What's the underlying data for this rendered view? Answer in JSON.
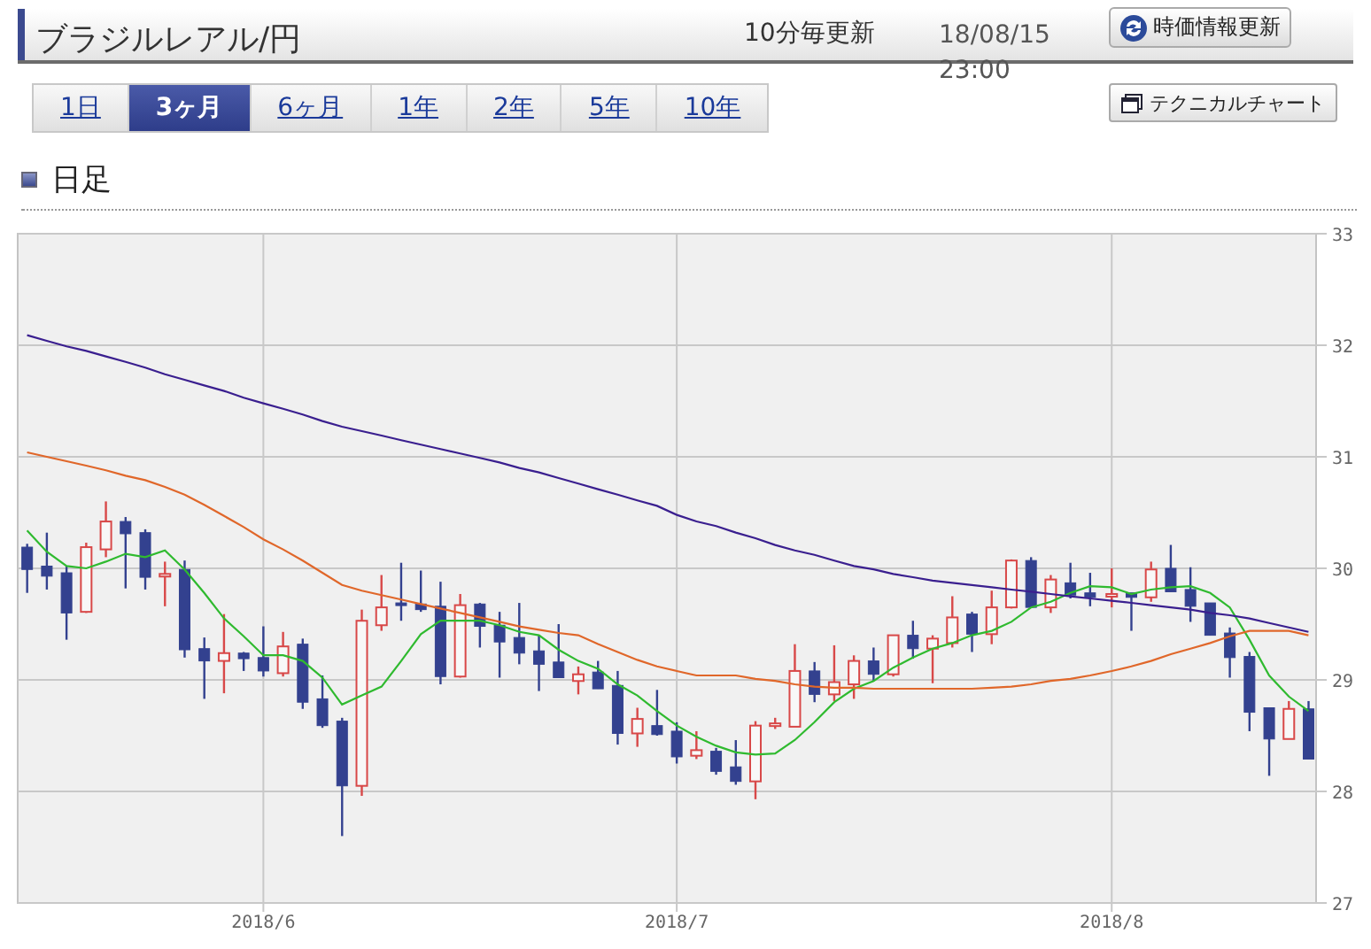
{
  "header": {
    "title": "ブラジルレアル/円",
    "update_interval": "10分毎更新",
    "timestamp": "18/08/15 23:00",
    "refresh_button": "時価情報更新"
  },
  "period_tabs": [
    {
      "label": "1日",
      "selected": false
    },
    {
      "label": "3ヶ月",
      "selected": true
    },
    {
      "label": "6ヶ月",
      "selected": false
    },
    {
      "label": "1年",
      "selected": false
    },
    {
      "label": "2年",
      "selected": false
    },
    {
      "label": "5年",
      "selected": false
    },
    {
      "label": "10年",
      "selected": false
    }
  ],
  "technical_chart_button": "テクニカルチャート",
  "section": {
    "title": "日足",
    "chart_data": {
      "type": "candlestick",
      "grid": true,
      "categories": [
        null,
        null,
        null,
        null,
        null,
        null,
        null,
        null,
        null,
        null,
        null,
        null,
        "2018/6",
        null,
        null,
        null,
        null,
        null,
        null,
        null,
        null,
        null,
        null,
        null,
        null,
        null,
        null,
        null,
        null,
        null,
        null,
        null,
        null,
        "2018/7",
        null,
        null,
        null,
        null,
        null,
        null,
        null,
        null,
        null,
        null,
        null,
        null,
        null,
        null,
        null,
        null,
        null,
        null,
        null,
        null,
        null,
        "2018/8",
        null,
        null,
        null,
        null,
        null,
        null,
        null,
        null,
        null,
        null
      ],
      "ylim": [
        27,
        33
      ],
      "yticks": [
        27,
        28,
        29,
        30,
        31,
        32,
        33
      ],
      "series": [
        {
          "type": "line",
          "color": "#2fba2f",
          "values": [
            30.34,
            30.15,
            30.02,
            30.0,
            30.06,
            30.13,
            30.1,
            30.16,
            29.99,
            29.78,
            29.55,
            29.39,
            29.22,
            29.22,
            29.17,
            29.02,
            28.78,
            28.86,
            28.94,
            29.17,
            29.41,
            29.53,
            29.53,
            29.53,
            29.49,
            29.43,
            29.4,
            29.27,
            29.17,
            29.1,
            28.96,
            28.86,
            28.72,
            28.59,
            28.49,
            28.41,
            28.35,
            28.33,
            28.34,
            28.46,
            28.62,
            28.8,
            28.92,
            28.99,
            29.11,
            29.2,
            29.28,
            29.33,
            29.4,
            29.44,
            29.52,
            29.65,
            29.7,
            29.78,
            29.84,
            29.83,
            29.77,
            29.81,
            29.83,
            29.84,
            29.78,
            29.65,
            29.36,
            29.04,
            28.85,
            28.72
          ]
        },
        {
          "type": "line",
          "color": "#e0672a",
          "values": [
            31.04,
            31.0,
            30.96,
            30.92,
            30.88,
            30.83,
            30.79,
            30.73,
            30.66,
            30.57,
            30.47,
            30.37,
            30.26,
            30.17,
            30.07,
            29.96,
            29.85,
            29.8,
            29.76,
            29.72,
            29.68,
            29.64,
            29.6,
            29.56,
            29.52,
            29.48,
            29.45,
            29.42,
            29.4,
            29.32,
            29.25,
            29.18,
            29.12,
            29.08,
            29.04,
            29.04,
            29.04,
            29.01,
            28.99,
            28.96,
            28.94,
            28.93,
            28.93,
            28.92,
            28.92,
            28.92,
            28.92,
            28.92,
            28.92,
            28.93,
            28.94,
            28.96,
            28.99,
            29.01,
            29.04,
            29.08,
            29.12,
            29.17,
            29.23,
            29.28,
            29.33,
            29.39,
            29.44,
            29.44,
            29.44,
            29.4
          ]
        },
        {
          "type": "line",
          "color": "#3a1f8f",
          "values": [
            32.09,
            32.04,
            31.99,
            31.95,
            31.9,
            31.85,
            31.8,
            31.74,
            31.69,
            31.64,
            31.59,
            31.53,
            31.48,
            31.43,
            31.38,
            31.32,
            31.27,
            31.23,
            31.19,
            31.15,
            31.11,
            31.07,
            31.03,
            30.99,
            30.95,
            30.9,
            30.86,
            30.81,
            30.76,
            30.71,
            30.66,
            30.61,
            30.56,
            30.48,
            30.42,
            30.38,
            30.32,
            30.27,
            30.21,
            30.16,
            30.12,
            30.07,
            30.02,
            29.99,
            29.95,
            29.92,
            29.89,
            29.87,
            29.85,
            29.83,
            29.81,
            29.79,
            29.77,
            29.75,
            29.73,
            29.71,
            29.69,
            29.67,
            29.65,
            29.63,
            29.6,
            29.58,
            29.55,
            29.51,
            29.47,
            29.43
          ]
        }
      ],
      "ohlc": [
        [
          30.19,
          30.22,
          29.78,
          29.99
        ],
        [
          30.02,
          30.32,
          29.81,
          29.93
        ],
        [
          29.96,
          30.02,
          29.36,
          29.6
        ],
        [
          29.61,
          30.23,
          29.6,
          30.19
        ],
        [
          30.17,
          30.6,
          30.1,
          30.42
        ],
        [
          30.42,
          30.46,
          29.82,
          30.31
        ],
        [
          30.32,
          30.35,
          29.81,
          29.92
        ],
        [
          29.94,
          30.06,
          29.66,
          29.95
        ],
        [
          29.99,
          30.07,
          29.2,
          29.27
        ],
        [
          29.28,
          29.38,
          28.83,
          29.17
        ],
        [
          29.17,
          29.59,
          28.88,
          29.24
        ],
        [
          29.24,
          29.25,
          29.08,
          29.19
        ],
        [
          29.2,
          29.48,
          29.03,
          29.08
        ],
        [
          29.06,
          29.43,
          29.03,
          29.3
        ],
        [
          29.32,
          29.37,
          28.74,
          28.8
        ],
        [
          28.83,
          29.04,
          28.57,
          28.59
        ],
        [
          28.63,
          28.66,
          27.6,
          28.05
        ],
        [
          28.05,
          29.63,
          27.96,
          29.53
        ],
        [
          29.49,
          29.94,
          29.44,
          29.65
        ],
        [
          29.69,
          30.05,
          29.53,
          29.67
        ],
        [
          29.68,
          29.98,
          29.61,
          29.63
        ],
        [
          29.66,
          29.88,
          28.96,
          29.03
        ],
        [
          29.03,
          29.77,
          29.02,
          29.67
        ],
        [
          29.68,
          29.69,
          29.29,
          29.48
        ],
        [
          29.49,
          29.61,
          29.02,
          29.34
        ],
        [
          29.38,
          29.69,
          29.14,
          29.24
        ],
        [
          29.26,
          29.4,
          28.9,
          29.14
        ],
        [
          29.16,
          29.5,
          29.02,
          29.02
        ],
        [
          28.99,
          29.12,
          28.87,
          29.05
        ],
        [
          29.07,
          29.17,
          28.92,
          28.92
        ],
        [
          28.95,
          29.08,
          28.42,
          28.52
        ],
        [
          28.52,
          28.75,
          28.4,
          28.65
        ],
        [
          28.59,
          28.91,
          28.5,
          28.51
        ],
        [
          28.54,
          28.62,
          28.25,
          28.31
        ],
        [
          28.32,
          28.54,
          28.29,
          28.37
        ],
        [
          28.36,
          28.39,
          28.15,
          28.18
        ],
        [
          28.22,
          28.46,
          28.06,
          28.09
        ],
        [
          28.09,
          28.63,
          27.93,
          28.59
        ],
        [
          28.6,
          28.66,
          28.56,
          28.61
        ],
        [
          28.58,
          29.32,
          28.58,
          29.08
        ],
        [
          29.08,
          29.16,
          28.8,
          28.87
        ],
        [
          28.87,
          29.31,
          28.81,
          28.98
        ],
        [
          28.96,
          29.22,
          28.83,
          29.17
        ],
        [
          29.17,
          29.29,
          28.99,
          29.05
        ],
        [
          29.05,
          29.4,
          29.03,
          29.4
        ],
        [
          29.4,
          29.53,
          29.19,
          29.28
        ],
        [
          29.28,
          29.4,
          28.97,
          29.37
        ],
        [
          29.33,
          29.75,
          29.29,
          29.56
        ],
        [
          29.59,
          29.61,
          29.25,
          29.41
        ],
        [
          29.41,
          29.8,
          29.32,
          29.65
        ],
        [
          29.65,
          30.08,
          29.64,
          30.07
        ],
        [
          30.07,
          30.1,
          29.65,
          29.65
        ],
        [
          29.65,
          29.94,
          29.6,
          29.9
        ],
        [
          29.87,
          30.05,
          29.73,
          29.76
        ],
        [
          29.78,
          29.96,
          29.66,
          29.74
        ],
        [
          29.76,
          30.0,
          29.65,
          29.77
        ],
        [
          29.78,
          29.78,
          29.44,
          29.74
        ],
        [
          29.74,
          30.06,
          29.7,
          29.99
        ],
        [
          30.0,
          30.21,
          29.79,
          29.79
        ],
        [
          29.81,
          30.01,
          29.52,
          29.66
        ],
        [
          29.69,
          29.69,
          29.4,
          29.4
        ],
        [
          29.42,
          29.47,
          29.02,
          29.2
        ],
        [
          29.21,
          29.25,
          28.54,
          28.71
        ],
        [
          28.75,
          28.75,
          28.14,
          28.47
        ],
        [
          28.47,
          28.81,
          28.47,
          28.74
        ],
        [
          28.74,
          28.81,
          28.29,
          28.29
        ]
      ]
    }
  }
}
